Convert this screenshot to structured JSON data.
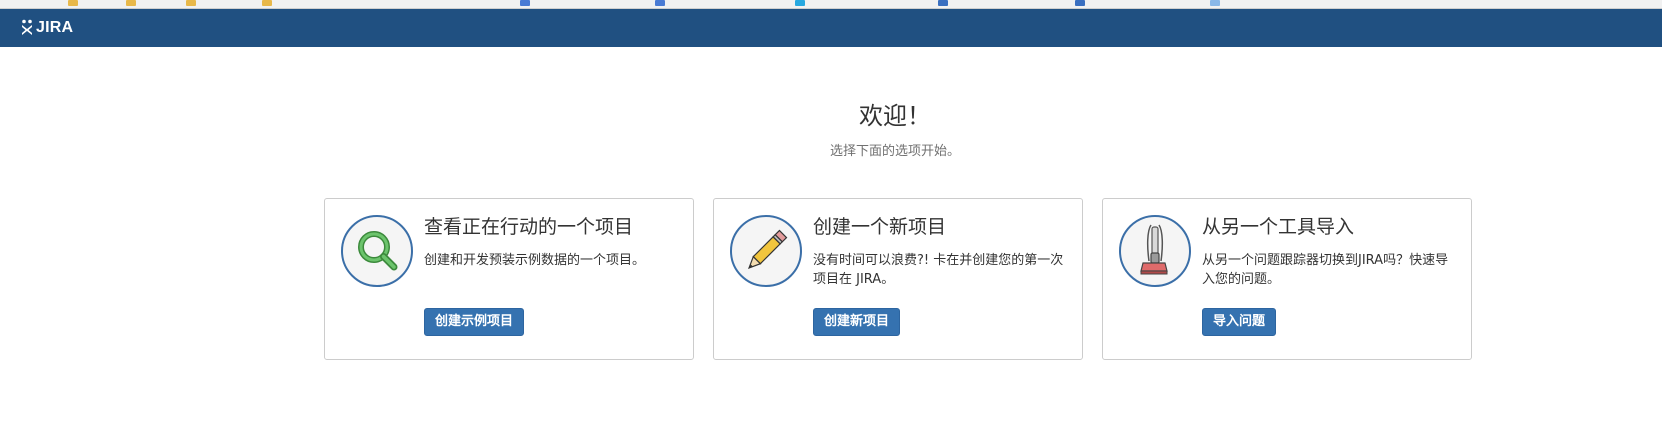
{
  "header": {
    "logo_text": "JIRA"
  },
  "welcome": {
    "title": "欢迎！",
    "subtitle": "选择下面的选项开始。"
  },
  "cards": [
    {
      "title": "查看正在行动的一个项目",
      "description": "创建和开发预装示例数据的一个项目。",
      "button_label": "创建示例项目",
      "icon": "magnifier-icon"
    },
    {
      "title": "创建一个新项目",
      "description": "没有时间可以浪费?! 卡在并创建您的第一次项目在 JIRA。",
      "button_label": "创建新项目",
      "icon": "pencil-icon"
    },
    {
      "title": "从另一个工具导入",
      "description": "从另一个问题跟踪器切换到JIRA吗？快速导入您的问题。",
      "button_label": "导入问题",
      "icon": "vacuum-cleaner-icon"
    }
  ],
  "colors": {
    "header_bg": "#205081",
    "button_bg": "#3572b0",
    "icon_ring": "#3b6fa8"
  }
}
